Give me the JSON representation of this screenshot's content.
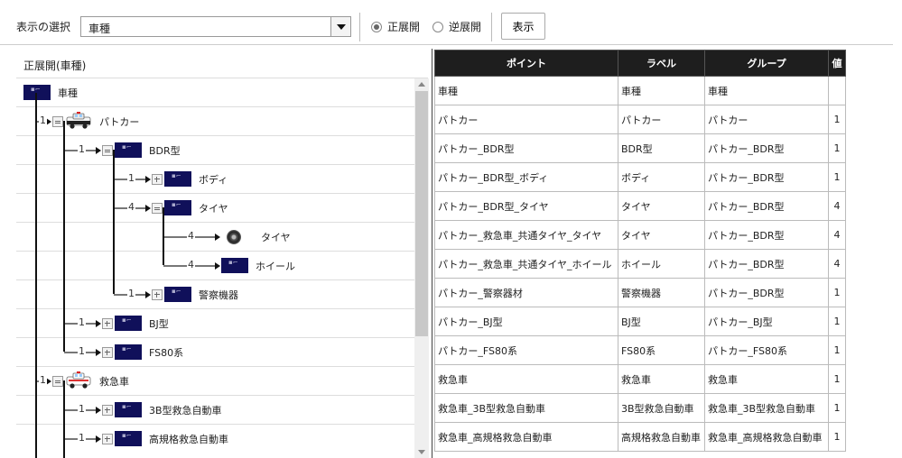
{
  "toolbar": {
    "select_label": "表示の選択",
    "select_value": "車種",
    "radio_forward": "正展開",
    "radio_reverse": "逆展開",
    "selected_radio": "正展開",
    "show_button": "表示"
  },
  "tree": {
    "title": "正展開(車種)",
    "nodes": [
      {
        "label": "車種",
        "num": "",
        "icon": "chip-icon"
      },
      {
        "label": "パトカー",
        "num": "1",
        "icon": "police-car-icon"
      },
      {
        "label": "BDR型",
        "num": "1",
        "icon": "chip-icon"
      },
      {
        "label": "ボディ",
        "num": "1",
        "icon": "chip-icon"
      },
      {
        "label": "タイヤ",
        "num": "4",
        "icon": "chip-icon"
      },
      {
        "label": "タイヤ",
        "num": "4",
        "icon": "tire-icon"
      },
      {
        "label": "ホイール",
        "num": "4",
        "icon": "chip-icon"
      },
      {
        "label": "警察機器",
        "num": "1",
        "icon": "chip-icon"
      },
      {
        "label": "BJ型",
        "num": "1",
        "icon": "chip-icon"
      },
      {
        "label": "FS80系",
        "num": "1",
        "icon": "chip-icon"
      },
      {
        "label": "救急車",
        "num": "1",
        "icon": "ambulance-icon"
      },
      {
        "label": "3B型救急自動車",
        "num": "1",
        "icon": "chip-icon"
      },
      {
        "label": "高規格救急自動車",
        "num": "1",
        "icon": "chip-icon"
      }
    ]
  },
  "table": {
    "headers": [
      "ポイント",
      "ラベル",
      "グループ",
      "値"
    ],
    "rows": [
      [
        "車種",
        "車種",
        "車種",
        ""
      ],
      [
        "パトカー",
        "パトカー",
        "パトカー",
        "1"
      ],
      [
        "パトカー_BDR型",
        "BDR型",
        "パトカー_BDR型",
        "1"
      ],
      [
        "パトカー_BDR型_ボディ",
        "ボディ",
        "パトカー_BDR型",
        "1"
      ],
      [
        "パトカー_BDR型_タイヤ",
        "タイヤ",
        "パトカー_BDR型",
        "4"
      ],
      [
        "パトカー_救急車_共通タイヤ_タイヤ",
        "タイヤ",
        "パトカー_BDR型",
        "4"
      ],
      [
        "パトカー_救急車_共通タイヤ_ホイール",
        "ホイール",
        "パトカー_BDR型",
        "4"
      ],
      [
        "パトカー_警察器材",
        "警察機器",
        "パトカー_BDR型",
        "1"
      ],
      [
        "パトカー_BJ型",
        "BJ型",
        "パトカー_BJ型",
        "1"
      ],
      [
        "パトカー_FS80系",
        "FS80系",
        "パトカー_FS80系",
        "1"
      ],
      [
        "救急車",
        "救急車",
        "救急車",
        "1"
      ],
      [
        "救急車_3B型救急自動車",
        "3B型救急自動車",
        "救急車_3B型救急自動車",
        "1"
      ],
      [
        "救急車_高規格救急自動車",
        "高規格救急自動車",
        "救急車_高規格救急自動車",
        "1"
      ]
    ]
  }
}
